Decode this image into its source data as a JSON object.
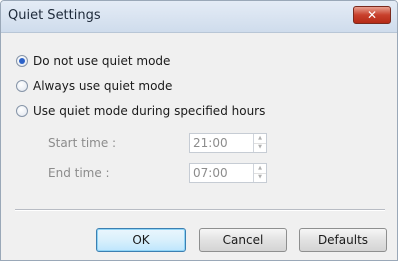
{
  "window": {
    "title": "Quiet Settings",
    "close_glyph": "✕"
  },
  "quiet_mode": {
    "options": [
      {
        "label": "Do not use quiet mode",
        "selected": true
      },
      {
        "label": "Always use quiet mode",
        "selected": false
      },
      {
        "label": "Use quiet mode during specified hours",
        "selected": false
      }
    ]
  },
  "hours": {
    "start_label": "Start time :",
    "start_value": "21:00",
    "end_label": "End time :",
    "end_value": "07:00",
    "enabled": false
  },
  "buttons": {
    "ok": "OK",
    "cancel": "Cancel",
    "defaults": "Defaults"
  },
  "colors": {
    "accent_radio": "#2c62c8",
    "close_button": "#c8402c",
    "disabled_text": "#8c8c8c"
  }
}
